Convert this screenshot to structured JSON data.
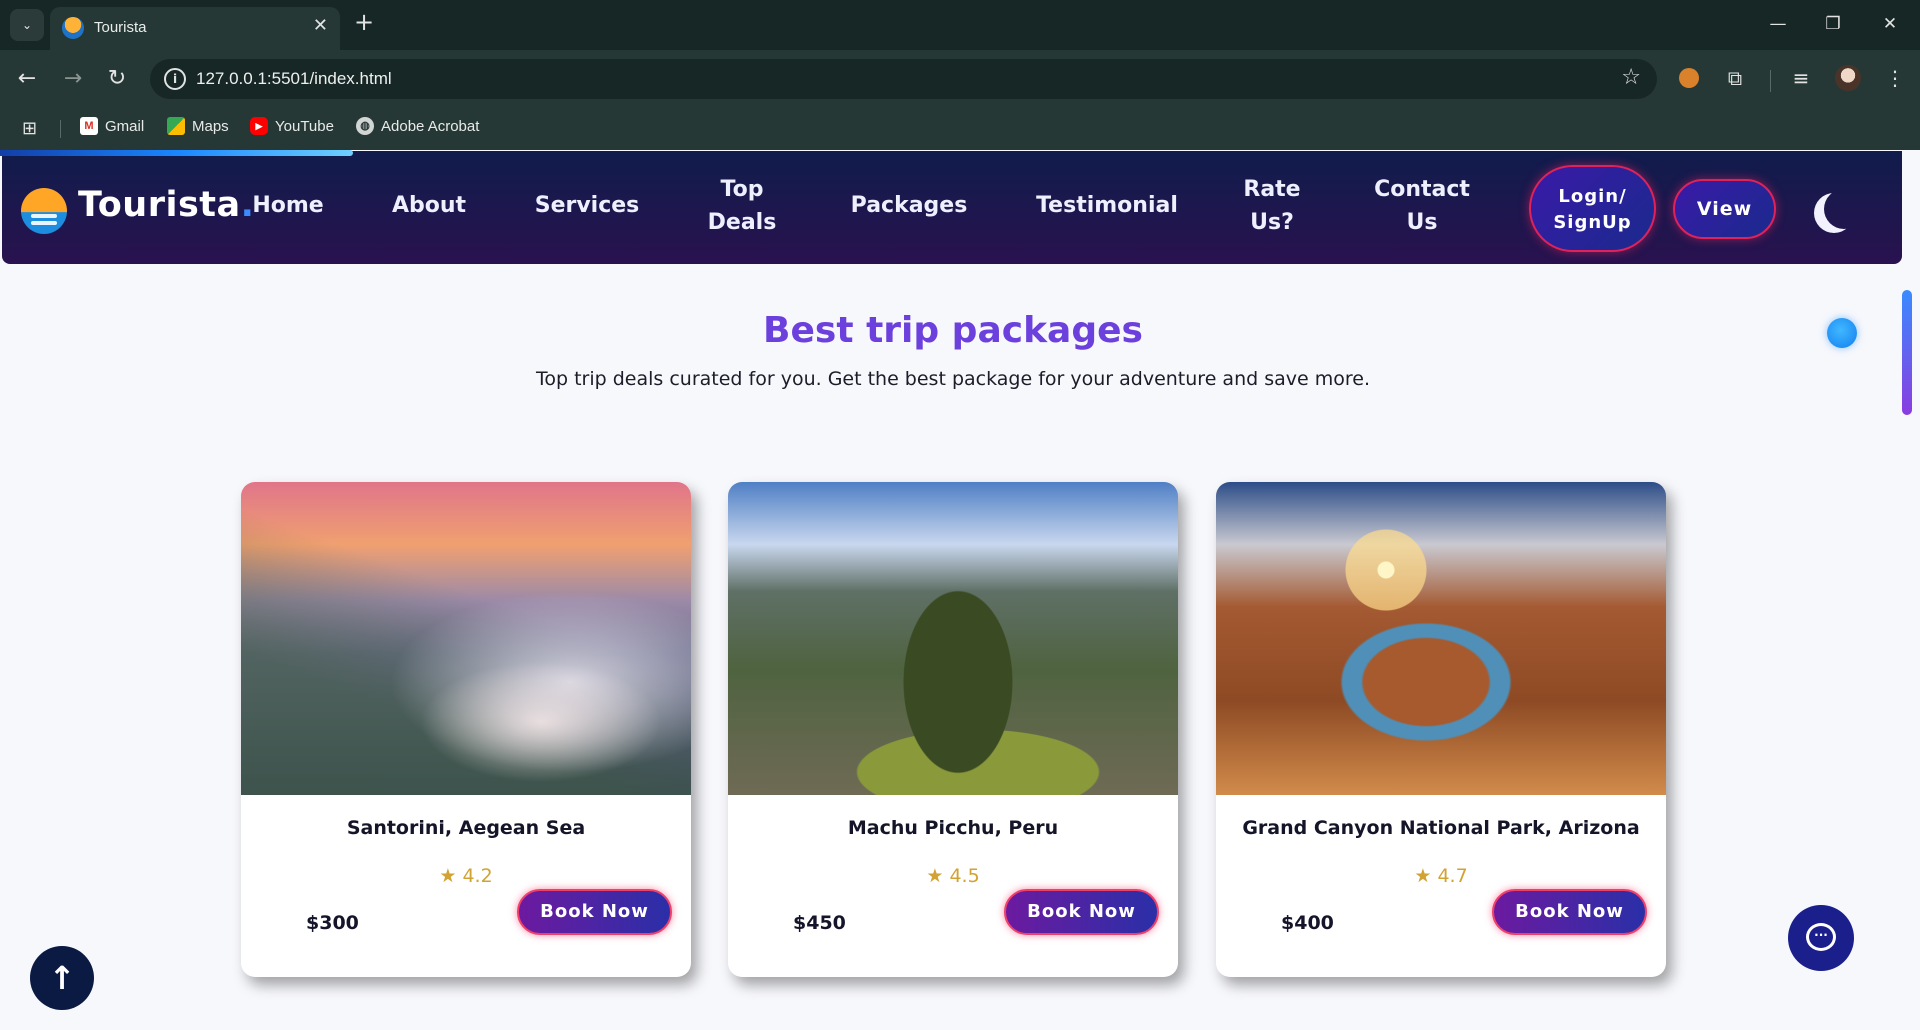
{
  "browser": {
    "tab_title": "Tourista",
    "tab_close": "✕",
    "new_tab": "+",
    "url": "127.0.0.1:5501/index.html",
    "bookmarks": [
      "Gmail",
      "Maps",
      "YouTube",
      "Adobe Acrobat"
    ],
    "icons": [
      "tab-search-icon",
      "favicon",
      "close-icon",
      "plus-icon",
      "minimize-icon",
      "restore-icon",
      "window-close-icon",
      "back-icon",
      "forward-icon",
      "reload-icon",
      "site-info-icon",
      "star-icon",
      "cookie-extension-icon",
      "puzzle-icon",
      "media-icon",
      "profile-avatar",
      "kebab-menu-icon",
      "apps-grid-icon"
    ]
  },
  "nav": {
    "brand": "Tourista",
    "brand_dot": ".",
    "links": {
      "home": "Home",
      "about": "About",
      "services": "Services",
      "top_deals": "Top Deals",
      "packages": "Packages",
      "testimonial": "Testimonial",
      "rate": "Rate Us?",
      "contact": "Contact Us"
    },
    "login": "Login/ SignUp",
    "view": "View"
  },
  "section": {
    "title": "Best trip packages",
    "subtitle": "Top trip deals curated for you. Get the best package for your adventure and save more."
  },
  "packages": [
    {
      "name": "Santorini, Aegean Sea",
      "rating": "4.2",
      "price": "$300",
      "button": "Book Now"
    },
    {
      "name": "Machu Picchu, Peru",
      "rating": "4.5",
      "price": "$450",
      "button": "Book Now"
    },
    {
      "name": "Grand Canyon National Park, Arizona",
      "rating": "4.7",
      "price": "$400",
      "button": "Book Now"
    }
  ],
  "colors": {
    "nav_top": "#101c4c",
    "nav_bottom": "#29124f",
    "accent_purple": "#6b40dc",
    "rating_gold": "#d2a332",
    "button_border": "#f0406a"
  }
}
